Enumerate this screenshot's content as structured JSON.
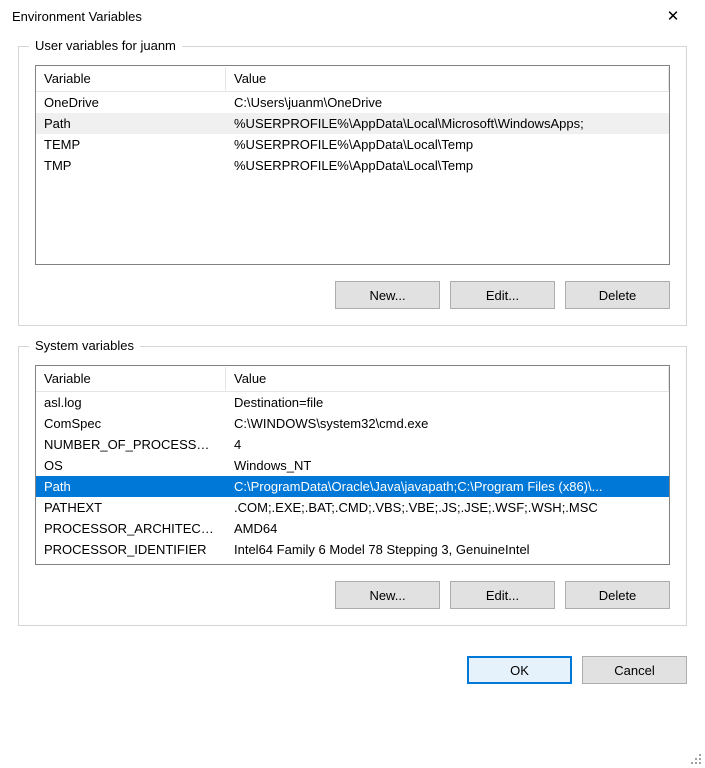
{
  "window": {
    "title": "Environment Variables"
  },
  "user_section": {
    "label": "User variables for juanm",
    "columns": {
      "variable": "Variable",
      "value": "Value"
    },
    "rows": [
      {
        "variable": "OneDrive",
        "value": "C:\\Users\\juanm\\OneDrive",
        "selected": false
      },
      {
        "variable": "Path",
        "value": "%USERPROFILE%\\AppData\\Local\\Microsoft\\WindowsApps;",
        "selected": "grey"
      },
      {
        "variable": "TEMP",
        "value": "%USERPROFILE%\\AppData\\Local\\Temp",
        "selected": false
      },
      {
        "variable": "TMP",
        "value": "%USERPROFILE%\\AppData\\Local\\Temp",
        "selected": false
      }
    ],
    "buttons": {
      "new": "New...",
      "edit": "Edit...",
      "delete": "Delete"
    }
  },
  "system_section": {
    "label": "System variables",
    "columns": {
      "variable": "Variable",
      "value": "Value"
    },
    "rows": [
      {
        "variable": "asl.log",
        "value": "Destination=file",
        "selected": false
      },
      {
        "variable": "ComSpec",
        "value": "C:\\WINDOWS\\system32\\cmd.exe",
        "selected": false
      },
      {
        "variable": "NUMBER_OF_PROCESSORS",
        "value": "4",
        "selected": false
      },
      {
        "variable": "OS",
        "value": "Windows_NT",
        "selected": false
      },
      {
        "variable": "Path",
        "value": "C:\\ProgramData\\Oracle\\Java\\javapath;C:\\Program Files (x86)\\...",
        "selected": "blue"
      },
      {
        "variable": "PATHEXT",
        "value": ".COM;.EXE;.BAT;.CMD;.VBS;.VBE;.JS;.JSE;.WSF;.WSH;.MSC",
        "selected": false
      },
      {
        "variable": "PROCESSOR_ARCHITECTU...",
        "value": "AMD64",
        "selected": false
      },
      {
        "variable": "PROCESSOR_IDENTIFIER",
        "value": "Intel64 Family 6 Model 78 Stepping 3, GenuineIntel",
        "selected": false
      }
    ],
    "buttons": {
      "new": "New...",
      "edit": "Edit...",
      "delete": "Delete"
    }
  },
  "dialog_buttons": {
    "ok": "OK",
    "cancel": "Cancel"
  }
}
